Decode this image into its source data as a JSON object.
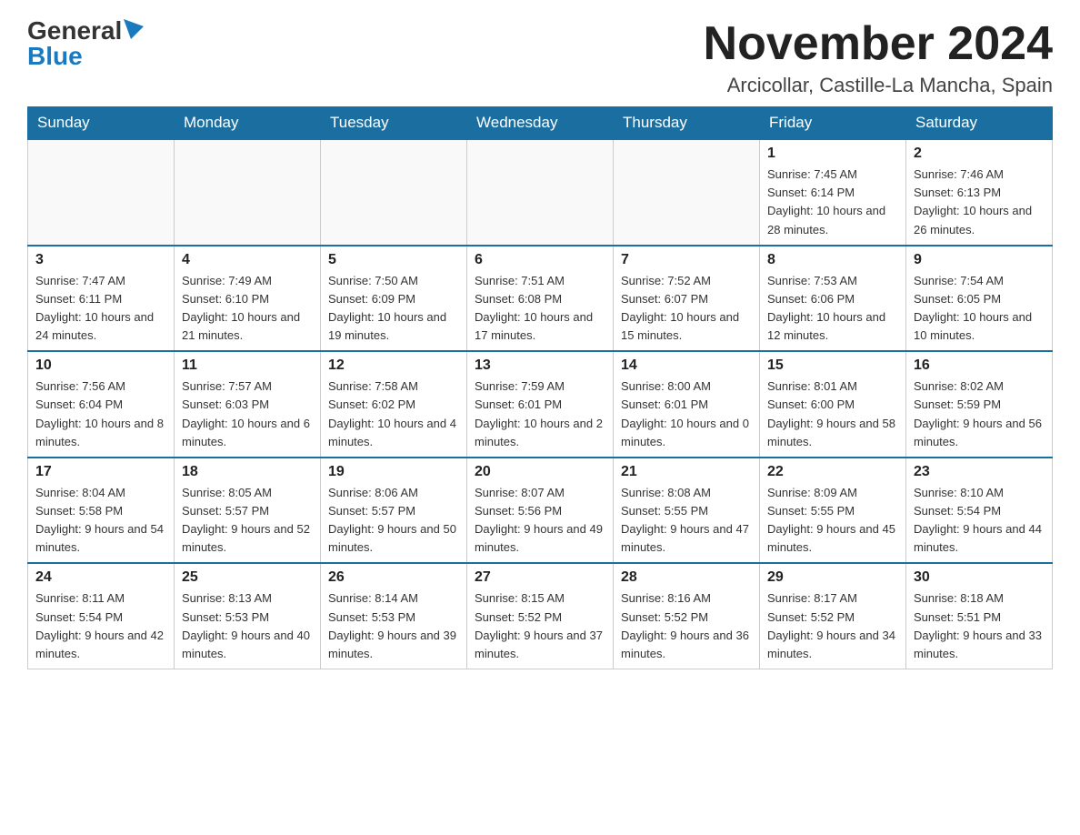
{
  "logo": {
    "general": "General",
    "blue": "Blue"
  },
  "header": {
    "month_year": "November 2024",
    "location": "Arcicollar, Castille-La Mancha, Spain"
  },
  "weekdays": [
    "Sunday",
    "Monday",
    "Tuesday",
    "Wednesday",
    "Thursday",
    "Friday",
    "Saturday"
  ],
  "weeks": [
    [
      {
        "day": "",
        "info": ""
      },
      {
        "day": "",
        "info": ""
      },
      {
        "day": "",
        "info": ""
      },
      {
        "day": "",
        "info": ""
      },
      {
        "day": "",
        "info": ""
      },
      {
        "day": "1",
        "info": "Sunrise: 7:45 AM\nSunset: 6:14 PM\nDaylight: 10 hours and 28 minutes."
      },
      {
        "day": "2",
        "info": "Sunrise: 7:46 AM\nSunset: 6:13 PM\nDaylight: 10 hours and 26 minutes."
      }
    ],
    [
      {
        "day": "3",
        "info": "Sunrise: 7:47 AM\nSunset: 6:11 PM\nDaylight: 10 hours and 24 minutes."
      },
      {
        "day": "4",
        "info": "Sunrise: 7:49 AM\nSunset: 6:10 PM\nDaylight: 10 hours and 21 minutes."
      },
      {
        "day": "5",
        "info": "Sunrise: 7:50 AM\nSunset: 6:09 PM\nDaylight: 10 hours and 19 minutes."
      },
      {
        "day": "6",
        "info": "Sunrise: 7:51 AM\nSunset: 6:08 PM\nDaylight: 10 hours and 17 minutes."
      },
      {
        "day": "7",
        "info": "Sunrise: 7:52 AM\nSunset: 6:07 PM\nDaylight: 10 hours and 15 minutes."
      },
      {
        "day": "8",
        "info": "Sunrise: 7:53 AM\nSunset: 6:06 PM\nDaylight: 10 hours and 12 minutes."
      },
      {
        "day": "9",
        "info": "Sunrise: 7:54 AM\nSunset: 6:05 PM\nDaylight: 10 hours and 10 minutes."
      }
    ],
    [
      {
        "day": "10",
        "info": "Sunrise: 7:56 AM\nSunset: 6:04 PM\nDaylight: 10 hours and 8 minutes."
      },
      {
        "day": "11",
        "info": "Sunrise: 7:57 AM\nSunset: 6:03 PM\nDaylight: 10 hours and 6 minutes."
      },
      {
        "day": "12",
        "info": "Sunrise: 7:58 AM\nSunset: 6:02 PM\nDaylight: 10 hours and 4 minutes."
      },
      {
        "day": "13",
        "info": "Sunrise: 7:59 AM\nSunset: 6:01 PM\nDaylight: 10 hours and 2 minutes."
      },
      {
        "day": "14",
        "info": "Sunrise: 8:00 AM\nSunset: 6:01 PM\nDaylight: 10 hours and 0 minutes."
      },
      {
        "day": "15",
        "info": "Sunrise: 8:01 AM\nSunset: 6:00 PM\nDaylight: 9 hours and 58 minutes."
      },
      {
        "day": "16",
        "info": "Sunrise: 8:02 AM\nSunset: 5:59 PM\nDaylight: 9 hours and 56 minutes."
      }
    ],
    [
      {
        "day": "17",
        "info": "Sunrise: 8:04 AM\nSunset: 5:58 PM\nDaylight: 9 hours and 54 minutes."
      },
      {
        "day": "18",
        "info": "Sunrise: 8:05 AM\nSunset: 5:57 PM\nDaylight: 9 hours and 52 minutes."
      },
      {
        "day": "19",
        "info": "Sunrise: 8:06 AM\nSunset: 5:57 PM\nDaylight: 9 hours and 50 minutes."
      },
      {
        "day": "20",
        "info": "Sunrise: 8:07 AM\nSunset: 5:56 PM\nDaylight: 9 hours and 49 minutes."
      },
      {
        "day": "21",
        "info": "Sunrise: 8:08 AM\nSunset: 5:55 PM\nDaylight: 9 hours and 47 minutes."
      },
      {
        "day": "22",
        "info": "Sunrise: 8:09 AM\nSunset: 5:55 PM\nDaylight: 9 hours and 45 minutes."
      },
      {
        "day": "23",
        "info": "Sunrise: 8:10 AM\nSunset: 5:54 PM\nDaylight: 9 hours and 44 minutes."
      }
    ],
    [
      {
        "day": "24",
        "info": "Sunrise: 8:11 AM\nSunset: 5:54 PM\nDaylight: 9 hours and 42 minutes."
      },
      {
        "day": "25",
        "info": "Sunrise: 8:13 AM\nSunset: 5:53 PM\nDaylight: 9 hours and 40 minutes."
      },
      {
        "day": "26",
        "info": "Sunrise: 8:14 AM\nSunset: 5:53 PM\nDaylight: 9 hours and 39 minutes."
      },
      {
        "day": "27",
        "info": "Sunrise: 8:15 AM\nSunset: 5:52 PM\nDaylight: 9 hours and 37 minutes."
      },
      {
        "day": "28",
        "info": "Sunrise: 8:16 AM\nSunset: 5:52 PM\nDaylight: 9 hours and 36 minutes."
      },
      {
        "day": "29",
        "info": "Sunrise: 8:17 AM\nSunset: 5:52 PM\nDaylight: 9 hours and 34 minutes."
      },
      {
        "day": "30",
        "info": "Sunrise: 8:18 AM\nSunset: 5:51 PM\nDaylight: 9 hours and 33 minutes."
      }
    ]
  ]
}
